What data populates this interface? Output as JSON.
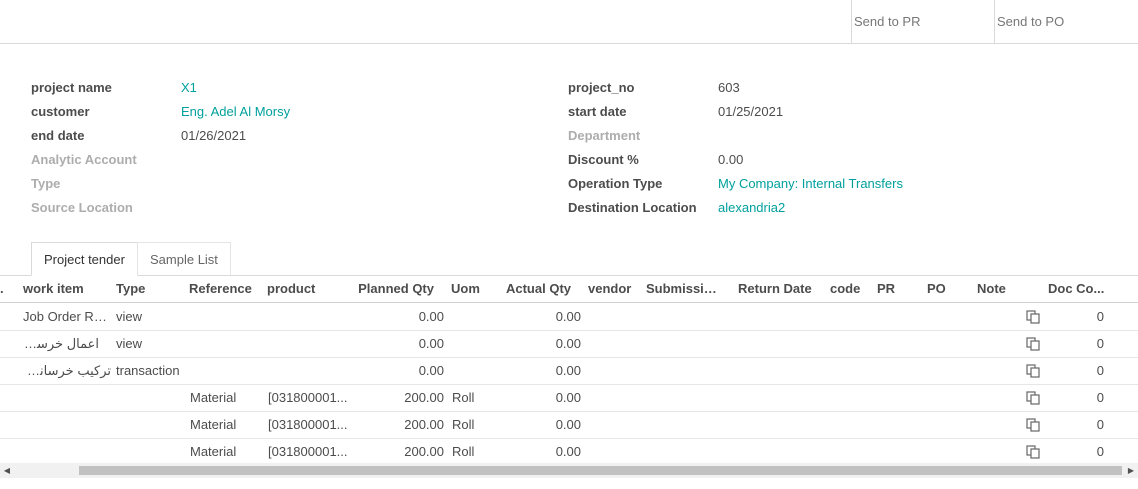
{
  "toolbar": {
    "send_to_pr": "Send to PR",
    "send_to_po": "Send to PO"
  },
  "form": {
    "left": [
      {
        "label": "project name",
        "value": "X1",
        "muted": false,
        "link": true
      },
      {
        "label": "customer",
        "value": "Eng. Adel Al Morsy",
        "muted": false,
        "link": true
      },
      {
        "label": "end date",
        "value": "01/26/2021",
        "muted": false,
        "link": false
      },
      {
        "label": "Analytic Account",
        "value": "",
        "muted": true,
        "link": false
      },
      {
        "label": "Type",
        "value": "",
        "muted": true,
        "link": false
      },
      {
        "label": "Source Location",
        "value": "",
        "muted": true,
        "link": false
      }
    ],
    "right": [
      {
        "label": "project_no",
        "value": "603",
        "muted": false,
        "link": false
      },
      {
        "label": "start date",
        "value": "01/25/2021",
        "muted": false,
        "link": false
      },
      {
        "label": "Department",
        "value": "",
        "muted": true,
        "link": false
      },
      {
        "label": "Discount %",
        "value": "0.00",
        "muted": false,
        "link": false
      },
      {
        "label": "Operation Type",
        "value": "My Company: Internal Transfers",
        "muted": false,
        "link": true
      },
      {
        "label": "Destination Location",
        "value": "alexandria2",
        "muted": false,
        "link": true
      }
    ]
  },
  "tabs": [
    {
      "label": "Project tender",
      "active": true
    },
    {
      "label": "Sample List",
      "active": false
    }
  ],
  "table": {
    "leading_cell": ".",
    "columns": {
      "work_item": "work item",
      "type": "Type",
      "reference": "Reference",
      "product": "product",
      "planned_qty": "Planned Qty",
      "uom": "Uom",
      "actual_qty": "Actual Qty",
      "vendor": "vendor",
      "submission": "Submissio...",
      "return_date": "Return Date",
      "code": "code",
      "pr": "PR",
      "po": "PO",
      "note": "Note",
      "doc_count": "Doc Co..."
    },
    "rows": [
      {
        "work_item": "Job Order Re...",
        "type": "view",
        "reference": "",
        "product": "",
        "planned_qty": "0.00",
        "uom": "",
        "actual_qty": "0.00",
        "doc_count": "0"
      },
      {
        "work_item": "اعمال خرسانيه",
        "type": "view",
        "reference": "",
        "product": "",
        "planned_qty": "0.00",
        "uom": "",
        "actual_qty": "0.00",
        "doc_count": "0"
      },
      {
        "work_item": "تركيب خرسانة...",
        "type": "transaction",
        "reference": "",
        "product": "",
        "planned_qty": "0.00",
        "uom": "",
        "actual_qty": "0.00",
        "doc_count": "0"
      },
      {
        "work_item": "",
        "type": "",
        "reference": "Material",
        "product": "[031800001...",
        "planned_qty": "200.00",
        "uom": "Roll",
        "actual_qty": "0.00",
        "doc_count": "0"
      },
      {
        "work_item": "",
        "type": "",
        "reference": "Material",
        "product": "[031800001...",
        "planned_qty": "200.00",
        "uom": "Roll",
        "actual_qty": "0.00",
        "doc_count": "0"
      },
      {
        "work_item": "",
        "type": "",
        "reference": "Material",
        "product": "[031800001...",
        "planned_qty": "200.00",
        "uom": "Roll",
        "actual_qty": "0.00",
        "doc_count": "0"
      }
    ]
  },
  "icons": {
    "row_action": "copy-icon",
    "scroll_left": "arrow-left-icon",
    "scroll_right": "arrow-right-icon"
  },
  "colors": {
    "link": "#00a09d",
    "muted_label": "#adadad",
    "text": "#4c4c4c"
  }
}
